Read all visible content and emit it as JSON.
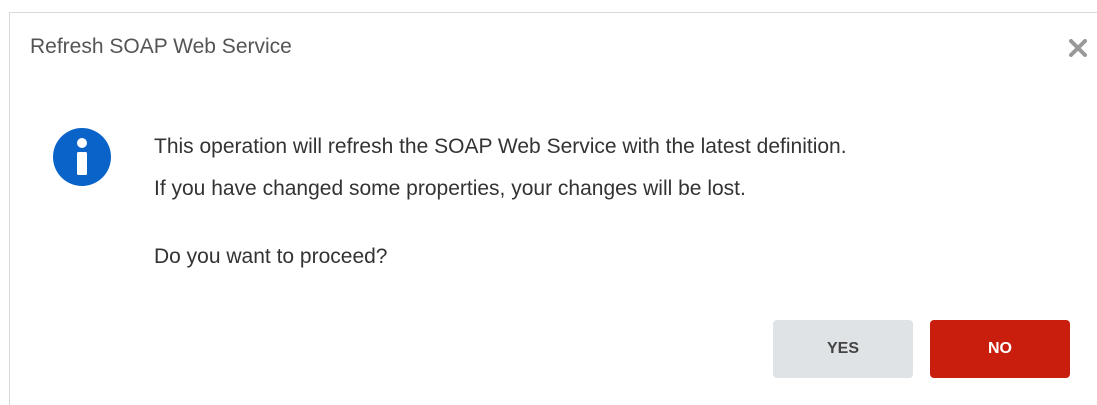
{
  "dialog": {
    "title": "Refresh SOAP Web Service",
    "message_lines": [
      "This operation will refresh the SOAP Web Service with the latest definition.",
      "If you have changed some properties, your changes will be lost."
    ],
    "question": "Do you want to proceed?",
    "buttons": {
      "yes_label": "YES",
      "no_label": "NO"
    },
    "icons": {
      "close": "close-icon",
      "info": "info-icon"
    },
    "colors": {
      "info_icon": "#0a63c9",
      "no_button": "#c91e0d",
      "yes_button": "#dfe3e6",
      "close_icon": "#999999"
    }
  }
}
